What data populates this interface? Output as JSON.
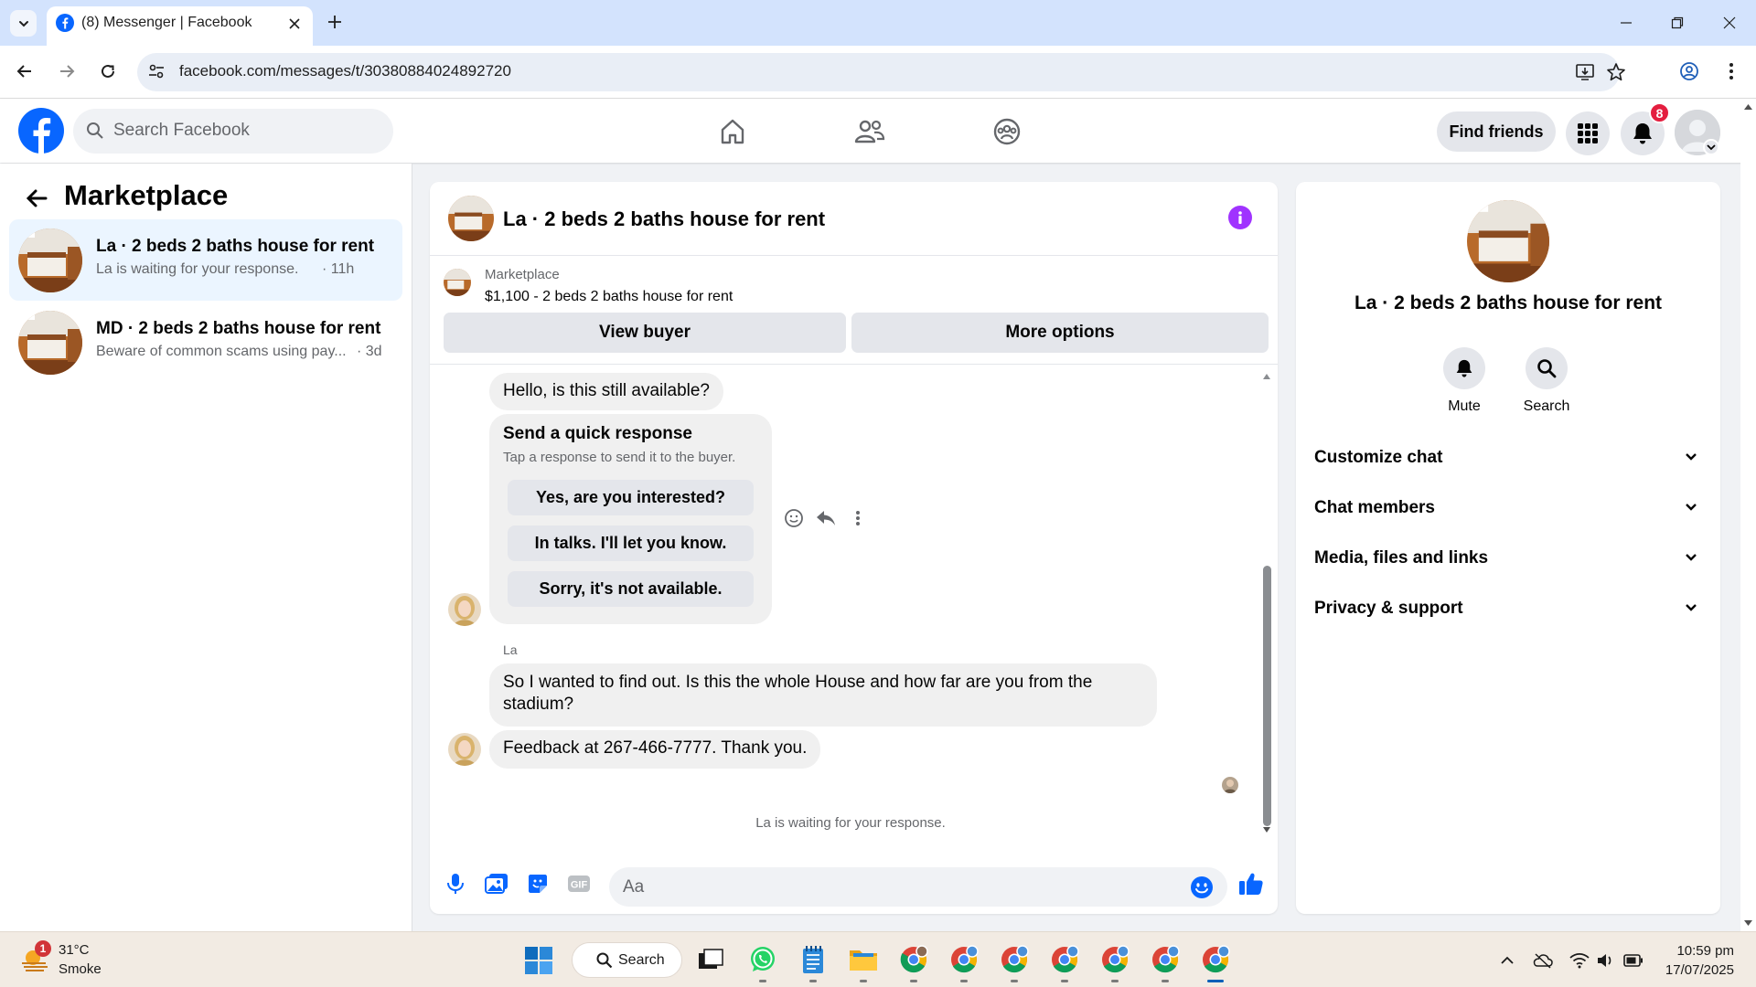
{
  "browser": {
    "tab_title": "(8) Messenger | Facebook",
    "url": "facebook.com/messages/t/30380884024892720"
  },
  "fb_header": {
    "search_placeholder": "Search Facebook",
    "find_friends_label": "Find friends",
    "notification_count": "8"
  },
  "sidebar": {
    "title": "Marketplace",
    "conversations": [
      {
        "name": "La · 2 beds 2 baths house for rent",
        "preview": "La is waiting for your response.",
        "time": " · 11h",
        "active": true
      },
      {
        "name": "MD · 2 beds 2 baths house for rent",
        "preview": "Beware of common scams using pay...",
        "time": " · 3d",
        "active": false
      }
    ]
  },
  "chat": {
    "title": "La · 2 beds 2 baths house for rent",
    "listing": {
      "category": "Marketplace",
      "price_title": "$1,100 - 2 beds 2 baths house for rent",
      "view_buyer_label": "View buyer",
      "more_options_label": "More options"
    },
    "messages": [
      {
        "text": "Hello, is this still available?"
      },
      {
        "text": "So I wanted to find out. Is this the whole House and how far are you from the stadium?"
      },
      {
        "text": "Feedback at 267-466-7777. Thank you."
      }
    ],
    "quick_response": {
      "title": "Send a quick response",
      "subtitle": "Tap a response to send it to the buyer.",
      "options": [
        "Yes, are you interested?",
        "In talks. I'll let you know.",
        "Sorry, it's not available."
      ]
    },
    "sender_name": "La",
    "waiting_text": "La is waiting for your response.",
    "composer": {
      "placeholder": "Aa",
      "gif_label": "GIF"
    }
  },
  "info_panel": {
    "title": "La · 2 beds 2 baths house for rent",
    "actions": [
      "Mute",
      "Search"
    ],
    "sections": [
      "Customize chat",
      "Chat members",
      "Media, files and links",
      "Privacy & support"
    ]
  },
  "taskbar": {
    "weather_badge": "1",
    "temperature": "31°C",
    "condition": "Smoke",
    "search_label": "Search",
    "time": "10:59 pm",
    "date": "17/07/2025"
  },
  "colors": {
    "fb_blue": "#0866ff",
    "messenger_purple": "#a033ff",
    "active_conversation": "#ebf5ff",
    "badge_red": "#e41e3f"
  },
  "icons": [
    "tab-list-icon",
    "facebook-favicon",
    "close-icon",
    "plus-icon",
    "minimize-icon",
    "restore-icon",
    "back-arrow-icon",
    "forward-arrow-icon",
    "reload-icon",
    "site-info-icon",
    "install-app-icon",
    "star-icon",
    "profile-icon",
    "menu-dots-icon",
    "home-icon",
    "friends-icon",
    "groups-icon",
    "apps-grid-icon",
    "bell-icon",
    "info-icon",
    "emoji-icon",
    "reply-icon",
    "microphone-icon",
    "image-icon",
    "sticker-icon",
    "gif-icon",
    "like-thumb-icon",
    "search-icon",
    "chevron-down-icon",
    "windows-start-icon",
    "whatsapp-icon",
    "chrome-icon",
    "wifi-icon",
    "volume-icon",
    "battery-icon"
  ]
}
